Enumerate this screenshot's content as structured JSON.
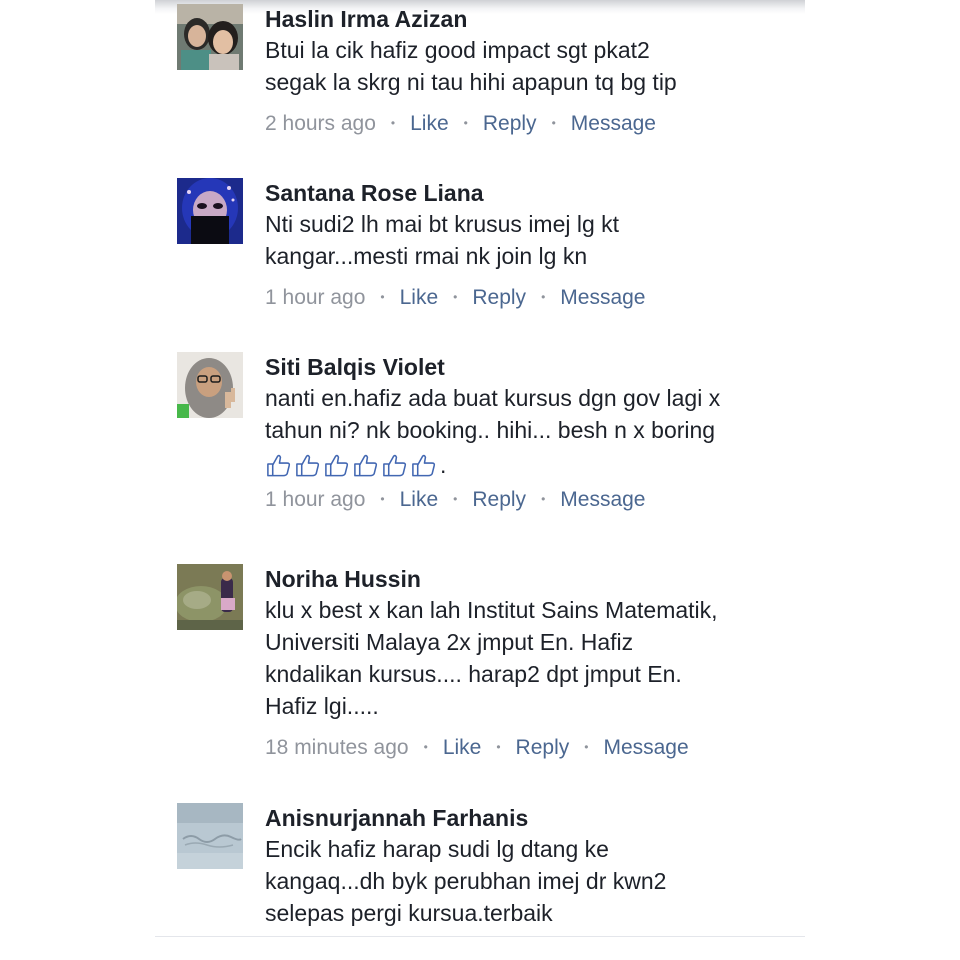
{
  "actions": {
    "like": "Like",
    "reply": "Reply",
    "message": "Message",
    "separator": "•"
  },
  "comments": [
    {
      "name": "Haslin Irma Azizan",
      "lines": [
        "Btui la cik hafiz good impact sgt pkat2",
        "segak la skrg ni tau hihi apapun tq bg tip"
      ],
      "time": "2 hours ago",
      "avatar_icon": "profile-photo-two-girls"
    },
    {
      "name": "Santana Rose Liana",
      "lines": [
        "Nti sudi2 lh mai bt krusus imej lg kt",
        "kangar...mesti rmai nk join lg kn"
      ],
      "time": "1 hour ago",
      "avatar_icon": "profile-photo-veiled-woman"
    },
    {
      "name": "Siti Balqis Violet",
      "lines": [
        "nanti en.hafiz ada buat kursus dgn gov lagi x",
        "tahun ni? nk booking.. hihi... besh n x boring"
      ],
      "emoji_count": 6,
      "emoji_icon": "thumbs-up-icon",
      "emoji_suffix": ".",
      "time": "1 hour ago",
      "avatar_icon": "profile-photo-hijab-glasses"
    },
    {
      "name": "Noriha Hussin",
      "lines": [
        "klu x best x kan lah Institut Sains Matematik,",
        "Universiti Malaya 2x jmput En. Hafiz",
        "kndalikan kursus.... harap2 dpt jmput En.",
        "Hafiz lgi....."
      ],
      "time": "18 minutes ago",
      "avatar_icon": "profile-photo-woman-by-rock"
    },
    {
      "name": "Anisnurjannah Farhanis",
      "lines": [
        "Encik hafiz harap sudi lg dtang ke",
        "kangaq...dh byk perubhan imej dr kwn2",
        "selepas pergi kursua.terbaik"
      ],
      "time": null,
      "avatar_icon": "profile-photo-sand-writing"
    }
  ]
}
